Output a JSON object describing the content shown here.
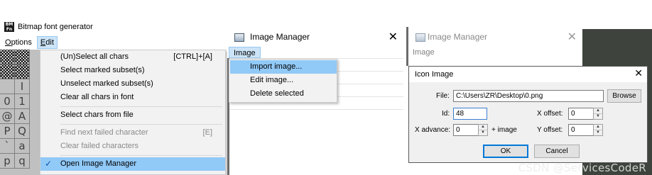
{
  "font_generator": {
    "title": "Bitmap font generator",
    "app_icon_text": "BM\nFont",
    "menu": [
      {
        "label": "Options",
        "underline": "O",
        "rest": "ptions"
      },
      {
        "label": "Edit",
        "underline": "E",
        "rest": "dit"
      }
    ],
    "grid_chars": [
      "",
      "",
      "",
      "",
      "",
      "I",
      "0",
      "1",
      "@",
      "A",
      "P",
      "Q",
      "`",
      "a",
      "p",
      "q"
    ],
    "edit_menu": {
      "items": [
        {
          "label": "(Un)Select all chars",
          "shortcut": "[CTRL]+[A]"
        },
        {
          "label": "Select marked subset(s)"
        },
        {
          "label": "Unselect marked subset(s)"
        },
        {
          "label": "Clear all chars in font"
        },
        {
          "label": "Select chars from file"
        },
        {
          "label": "Find next failed character",
          "shortcut": "[E]"
        },
        {
          "label": "Clear failed characters"
        },
        {
          "label": "Open Image Manager",
          "check": "✓"
        }
      ]
    }
  },
  "image_manager": {
    "title": "Image Manager",
    "close": "✕",
    "menu_label": "Image",
    "image_menu": [
      {
        "label": "Import image..."
      },
      {
        "label": "Edit image..."
      },
      {
        "label": "Delete selected"
      }
    ]
  },
  "image_manager_bg": {
    "title": "Image Manager",
    "close": "✕",
    "menu_label": "Image"
  },
  "icon_image_dialog": {
    "title": "Icon Image",
    "close": "✕",
    "file_label": "File:",
    "file_value": "C:\\Users\\ZR\\Desktop\\0.png",
    "browse_label": "Browse",
    "id_label": "Id:",
    "id_value": "48",
    "x_offset_label": "X offset:",
    "x_offset_value": "0",
    "x_advance_label": "X advance:",
    "x_advance_value": "0",
    "plus_image_label": "+ image",
    "y_offset_label": "Y offset:",
    "y_offset_value": "0",
    "ok_label": "OK",
    "cancel_label": "Cancel"
  },
  "watermark": "CSDN @ServicesCodeR",
  "colors": {
    "highlight": "#91c9f7",
    "menu_active": "#cce4f7",
    "dark_background": "#3e443d"
  }
}
